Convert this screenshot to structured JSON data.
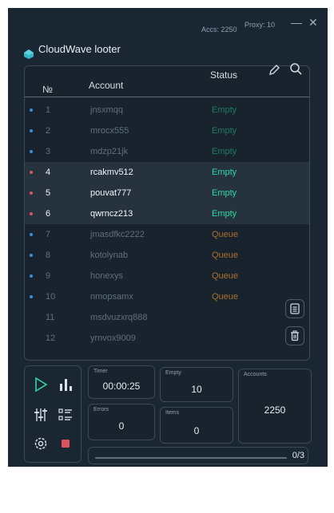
{
  "app": {
    "title": "CloudWave looter",
    "accs_text": "Accs: 2250",
    "proxy_text": "Proxy: 10"
  },
  "window_controls": {
    "minimize": "—",
    "close": "✕"
  },
  "table": {
    "headers": {
      "num": "№",
      "account": "Account",
      "status": "Status"
    },
    "rows": [
      {
        "num": "1",
        "account": "jnsxmqq",
        "status": "Empty",
        "dot": "#3d8fd6",
        "bright": false,
        "selected": false,
        "status_color": "#1f7a60"
      },
      {
        "num": "2",
        "account": "mrocx555",
        "status": "Empty",
        "dot": "#3d8fd6",
        "bright": false,
        "selected": false,
        "status_color": "#1f7a60"
      },
      {
        "num": "3",
        "account": "mdzp21jk",
        "status": "Empty",
        "dot": "#3d8fd6",
        "bright": false,
        "selected": false,
        "status_color": "#1f7a60"
      },
      {
        "num": "4",
        "account": "rcakmv512",
        "status": "Empty",
        "dot": "#e0525f",
        "bright": true,
        "selected": true,
        "status_color": "#2fd9a2"
      },
      {
        "num": "5",
        "account": "pouvat777",
        "status": "Empty",
        "dot": "#e0525f",
        "bright": true,
        "selected": true,
        "status_color": "#2fd9a2"
      },
      {
        "num": "6",
        "account": "qwrncz213",
        "status": "Empty",
        "dot": "#e0525f",
        "bright": true,
        "selected": true,
        "status_color": "#2fd9a2"
      },
      {
        "num": "7",
        "account": "jmasdfkc2222",
        "status": "Queue",
        "dot": "#3d8fd6",
        "bright": false,
        "selected": false,
        "status_color": "#a8702c"
      },
      {
        "num": "8",
        "account": "kotolynab",
        "status": "Queue",
        "dot": "#3d8fd6",
        "bright": false,
        "selected": false,
        "status_color": "#a8702c"
      },
      {
        "num": "9",
        "account": "honexys",
        "status": "Queue",
        "dot": "#3d8fd6",
        "bright": false,
        "selected": false,
        "status_color": "#a8702c"
      },
      {
        "num": "10",
        "account": "nmopsamx",
        "status": "Queue",
        "dot": "#3d8fd6",
        "bright": false,
        "selected": false,
        "status_color": "#a8702c"
      },
      {
        "num": "11",
        "account": "msdvuzxrq888",
        "status": "",
        "dot": "",
        "bright": false,
        "selected": false,
        "status_color": "#a8702c"
      },
      {
        "num": "12",
        "account": "yrnvox9009",
        "status": "",
        "dot": "",
        "bright": false,
        "selected": false,
        "status_color": "#a8702c"
      }
    ]
  },
  "stats": {
    "timer": {
      "label": "Timer",
      "value": "00:00:25"
    },
    "empty": {
      "label": "Empty",
      "value": "10"
    },
    "accounts": {
      "label": "Accounts",
      "value": "2250"
    },
    "errors": {
      "label": "Errors",
      "value": "0"
    },
    "items": {
      "label": "Items",
      "value": "0"
    }
  },
  "progress": {
    "text": "0/3",
    "fraction": 0
  },
  "colors": {
    "accent_green": "#2fd9a2",
    "stop_red": "#e0525f",
    "queue": "#a8702c"
  }
}
